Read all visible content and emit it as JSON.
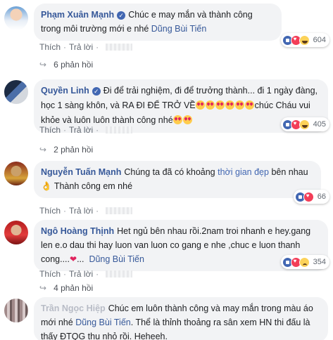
{
  "actions": {
    "like": "Thích",
    "reply": "Trả lời",
    "sep": "·"
  },
  "comments": [
    {
      "author": "Phạm Xuân Mạnh",
      "text": "Chúc e may mắn và thành công trong môi trường mới e nhé",
      "tag": "Dũng Bùi Tiến",
      "reactions": "604",
      "replies": "6 phản hồi"
    },
    {
      "author": "Quyền Linh",
      "text1": "Đi để trải nghiệm, đi để trưởng thành... đi 1 ngày đàng, học 1 sàng khôn, và RA ĐI ĐỂ TRỞ VỀ",
      "text2": "chúc Cháu vui khỏe và luôn luôn thành công nhé",
      "reactions": "405",
      "replies": "2 phản hồi"
    },
    {
      "author": "Nguyễn Tuấn Mạnh",
      "text_before": "Chúng ta đã có khoảng",
      "highlight": "thời gian đẹp",
      "text_after": "bên nhau",
      "text2": "Thành công em nhé",
      "reactions": "66"
    },
    {
      "author": "Ngô Hoàng Thịnh",
      "text": "Het ngủ bên nhau rồi.2nam troi nhanh e hey.gang len e.o dau thi hay luon van luon co gang e nhe ,chuc e luon thanh cong....",
      "tag": "Dũng Bùi Tiến",
      "reactions": "354",
      "replies": "4 phản hồi"
    },
    {
      "author": "Trần Ngọc Hiệp",
      "text": "Chúc em luôn thành công và may mắn trong màu áo mới nhé",
      "tag": "Dũng Bùi Tiến",
      "text2": ". Thể là thỉnh thoảng ra sân xem HN thi đấu là thấy ĐTQG thu nhỏ rồi. Heheeh."
    }
  ],
  "colors": {
    "link": "#365899",
    "bubble": "#f2f3f5",
    "meta": "#606770"
  }
}
